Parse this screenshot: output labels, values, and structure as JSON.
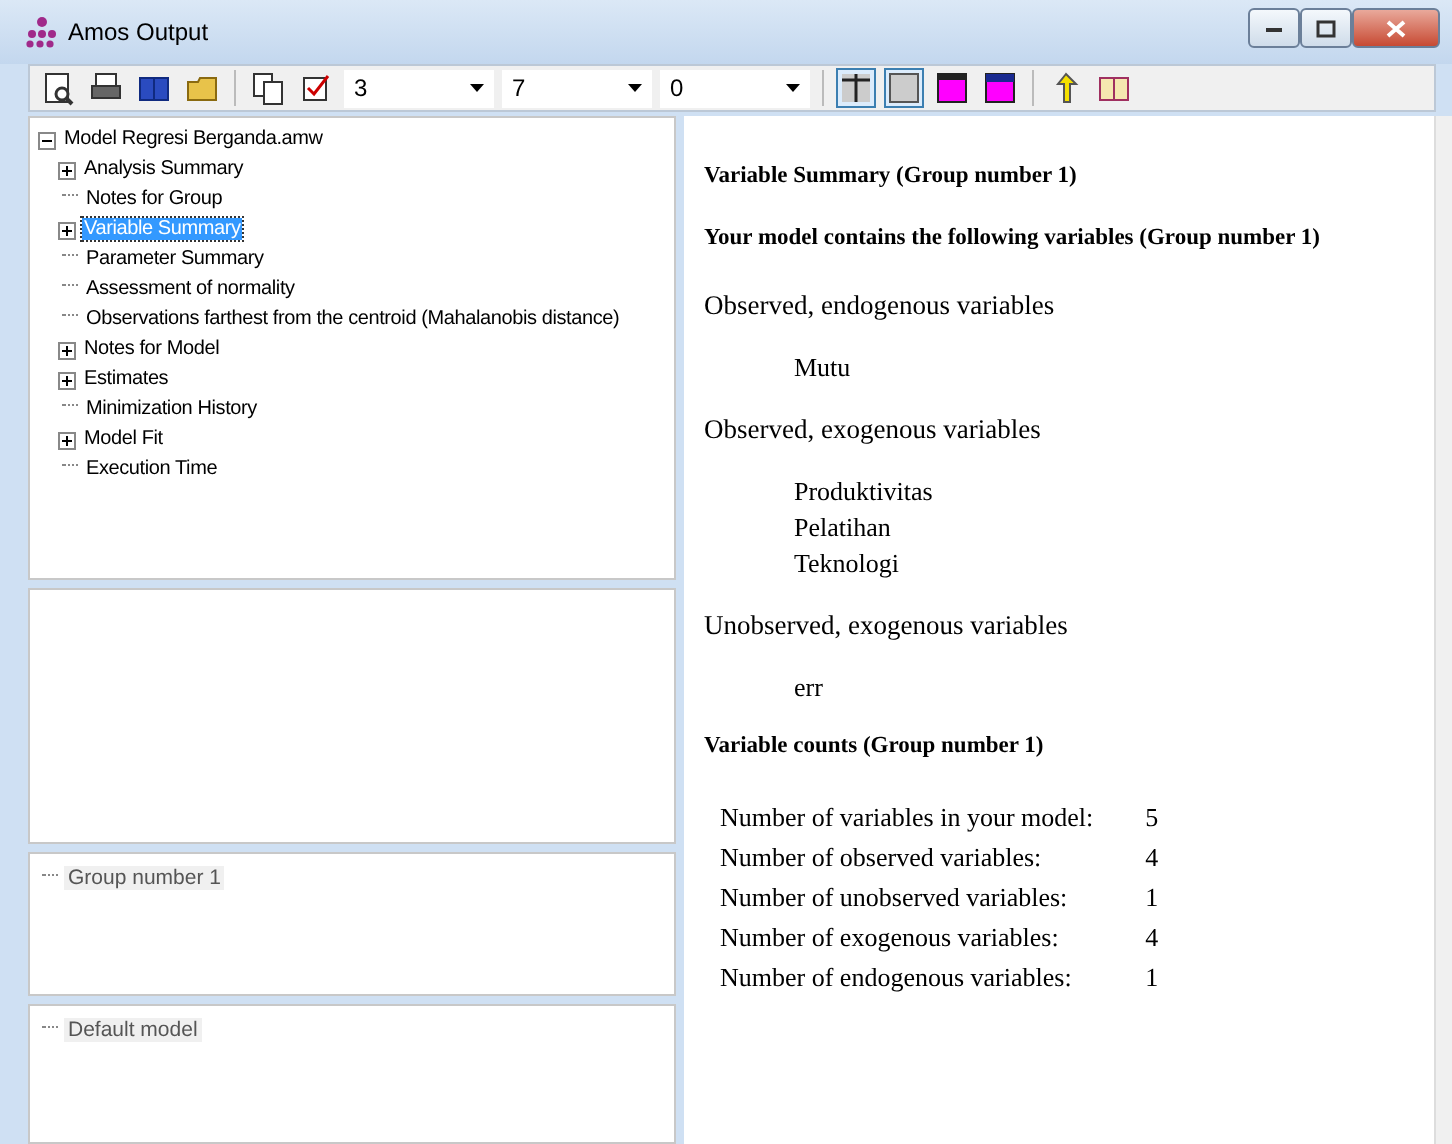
{
  "window": {
    "title": "Amos Output"
  },
  "toolbar": {
    "combos": [
      {
        "value": "3"
      },
      {
        "value": "7"
      },
      {
        "value": "0"
      }
    ],
    "toggles": [
      {
        "kind": "grid",
        "pressed": true
      },
      {
        "kind": "plain",
        "pressed": true
      },
      {
        "kind": "magenta-top",
        "pressed": false
      },
      {
        "kind": "navy-top",
        "pressed": false
      }
    ]
  },
  "tree": {
    "label": "Model Regresi Berganda.amw",
    "expanded": true,
    "children": [
      {
        "label": "Analysis Summary",
        "kind": "folder",
        "expanded": false,
        "selected": false
      },
      {
        "label": "Notes for Group",
        "kind": "leaf",
        "selected": false
      },
      {
        "label": "Variable Summary",
        "kind": "folder",
        "expanded": false,
        "selected": true
      },
      {
        "label": "Parameter Summary",
        "kind": "leaf",
        "selected": false
      },
      {
        "label": "Assessment of normality",
        "kind": "leaf",
        "selected": false
      },
      {
        "label": "Observations farthest from the centroid (Mahalanobis distance)",
        "kind": "leaf",
        "selected": false
      },
      {
        "label": "Notes for Model",
        "kind": "folder",
        "expanded": false,
        "selected": false
      },
      {
        "label": "Estimates",
        "kind": "folder",
        "expanded": false,
        "selected": false
      },
      {
        "label": "Minimization History",
        "kind": "leaf",
        "selected": false
      },
      {
        "label": "Model Fit",
        "kind": "folder",
        "expanded": false,
        "selected": false
      },
      {
        "label": "Execution Time",
        "kind": "leaf",
        "selected": false
      }
    ]
  },
  "groups": [
    {
      "label": "Group number 1"
    }
  ],
  "models": [
    {
      "label": "Default model"
    }
  ],
  "output": [
    {
      "kind": "heading",
      "text": "Variable Summary (Group number 1)"
    },
    {
      "kind": "heading",
      "text": "Your model contains the following variables (Group number 1)"
    },
    {
      "kind": "section",
      "text": "Observed, endogenous variables"
    },
    {
      "kind": "items",
      "items": [
        "Mutu"
      ]
    },
    {
      "kind": "section",
      "text": "Observed, exogenous variables"
    },
    {
      "kind": "items",
      "items": [
        "Produktivitas",
        "Pelatihan",
        "Teknologi"
      ]
    },
    {
      "kind": "section",
      "text": "Unobserved, exogenous variables"
    },
    {
      "kind": "items",
      "items": [
        "err"
      ]
    },
    {
      "kind": "heading",
      "text": "Variable counts (Group number 1)"
    },
    {
      "kind": "counts",
      "rows": [
        {
          "label": "Number of variables in your model:",
          "value": "5"
        },
        {
          "label": "Number of observed variables:",
          "value": "4"
        },
        {
          "label": "Number of unobserved variables:",
          "value": "1"
        },
        {
          "label": "Number of exogenous variables:",
          "value": "4"
        },
        {
          "label": "Number of endogenous variables:",
          "value": "1"
        }
      ]
    }
  ]
}
